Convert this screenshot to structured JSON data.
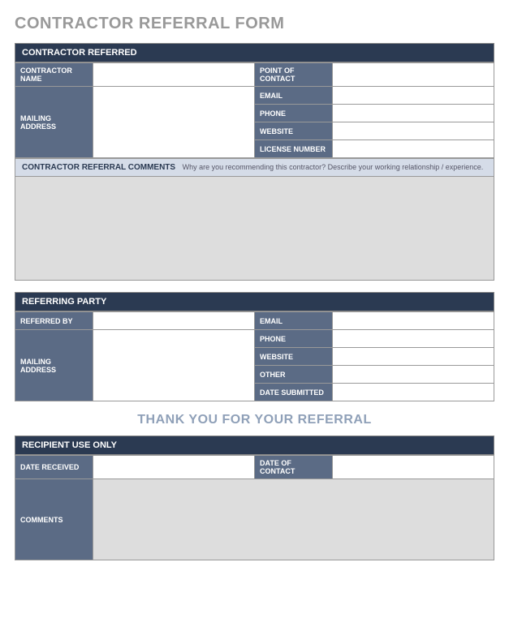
{
  "title": "CONTRACTOR REFERRAL FORM",
  "contractor_referred": {
    "header": "CONTRACTOR REFERRED",
    "fields": {
      "contractor_name": {
        "label": "CONTRACTOR NAME",
        "value": ""
      },
      "mailing_address": {
        "label": "MAILING ADDRESS",
        "value": ""
      },
      "point_of_contact": {
        "label": "POINT OF CONTACT",
        "value": ""
      },
      "email": {
        "label": "EMAIL",
        "value": ""
      },
      "phone": {
        "label": "PHONE",
        "value": ""
      },
      "website": {
        "label": "WEBSITE",
        "value": ""
      },
      "license_number": {
        "label": "LICENSE NUMBER",
        "value": ""
      }
    },
    "comments": {
      "label": "CONTRACTOR REFERRAL COMMENTS",
      "hint": "Why are you recommending this contractor? Describe your working relationship / experience.",
      "value": ""
    }
  },
  "referring_party": {
    "header": "REFERRING PARTY",
    "fields": {
      "referred_by": {
        "label": "REFERRED BY",
        "value": ""
      },
      "mailing_address": {
        "label": "MAILING ADDRESS",
        "value": ""
      },
      "email": {
        "label": "EMAIL",
        "value": ""
      },
      "phone": {
        "label": "PHONE",
        "value": ""
      },
      "website": {
        "label": "WEBSITE",
        "value": ""
      },
      "other": {
        "label": "OTHER",
        "value": ""
      },
      "date_submitted": {
        "label": "DATE SUBMITTED",
        "value": ""
      }
    }
  },
  "thank_you": "THANK YOU FOR YOUR REFERRAL",
  "recipient_use_only": {
    "header": "RECIPIENT USE ONLY",
    "fields": {
      "date_received": {
        "label": "DATE RECEIVED",
        "value": ""
      },
      "date_of_contact": {
        "label": "DATE OF CONTACT",
        "value": ""
      },
      "comments": {
        "label": "COMMENTS",
        "value": ""
      }
    }
  }
}
